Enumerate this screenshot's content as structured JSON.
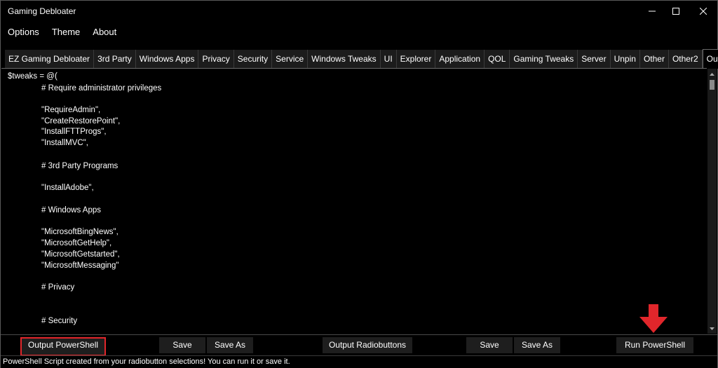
{
  "app": {
    "title": "Gaming Debloater"
  },
  "menu": {
    "items": [
      "Options",
      "Theme",
      "About"
    ]
  },
  "tabs": [
    "EZ Gaming Debloater",
    "3rd Party",
    "Windows Apps",
    "Privacy",
    "Security",
    "Service",
    "Windows Tweaks",
    "UI",
    "Explorer",
    "Application",
    "QOL",
    "Gaming Tweaks",
    "Server",
    "Unpin",
    "Other",
    "Other2",
    "Output"
  ],
  "active_tab": "Output",
  "editor": {
    "lines": [
      "$tweaks = @(",
      "# Require administrator privileges",
      "\"RequireAdmin\",",
      "\"CreateRestorePoint\",",
      "\"InstallFTTProgs\",",
      "\"InstallMVC\",",
      "# 3rd Party Programs",
      "\"InstallAdobe\",",
      "# Windows Apps",
      "\"MicrosoftBingNews\",",
      "\"MicrosoftGetHelp\",",
      "\"MicrosoftGetstarted\",",
      "\"MicrosoftMessaging\"",
      "# Privacy",
      "# Security"
    ]
  },
  "buttons": {
    "output_powershell": "Output PowerShell",
    "save_1": "Save",
    "save_as_1": "Save As",
    "output_radiobuttons": "Output Radiobuttons",
    "save_2": "Save",
    "save_as_2": "Save As",
    "run_powershell": "Run PowerShell"
  },
  "status": {
    "text": "PowerShell Script created from your radiobutton selections! You can run it or save it."
  },
  "colors": {
    "highlight": "#e1262b",
    "background": "#000000"
  }
}
